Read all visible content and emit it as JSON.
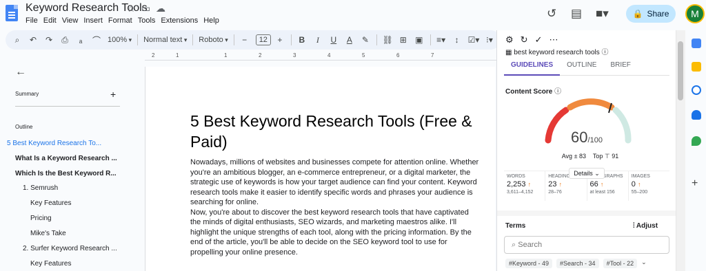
{
  "app": {
    "doc_title": "Keyword Research Tools",
    "menu": [
      "File",
      "Edit",
      "View",
      "Insert",
      "Format",
      "Tools",
      "Extensions",
      "Help"
    ],
    "share_label": "Share",
    "avatar_initial": "M"
  },
  "toolbar": {
    "zoom": "100%",
    "style": "Normal text",
    "font": "Roboto",
    "font_size": "12"
  },
  "ruler": [
    "2",
    "1",
    "1",
    "2",
    "3",
    "4",
    "5",
    "6",
    "7"
  ],
  "outline": {
    "summary_label": "Summary",
    "outline_label": "Outline",
    "items": [
      {
        "label": "5 Best Keyword Research To...",
        "level": "h1",
        "active": true
      },
      {
        "label": "What Is a Keyword Research ...",
        "level": "h1",
        "active": false
      },
      {
        "label": "Which Is the Best Keyword R...",
        "level": "h1",
        "active": false
      },
      {
        "label": "1. Semrush",
        "level": "h2",
        "active": false
      },
      {
        "label": "Key Features",
        "level": "h3",
        "active": false
      },
      {
        "label": "Pricing",
        "level": "h3",
        "active": false
      },
      {
        "label": "Mike's Take",
        "level": "h3",
        "active": false
      },
      {
        "label": "2. Surfer Keyword Research ...",
        "level": "h2",
        "active": false
      },
      {
        "label": "Key Features",
        "level": "h3",
        "active": false
      }
    ]
  },
  "document": {
    "heading": "5 Best Keyword Research Tools (Free & Paid)",
    "paragraphs": [
      "Nowadays, millions of websites and businesses compete for attention online. Whether you're an ambitious blogger, an e-commerce entrepreneur, or a digital marketer, the strategic use of keywords is how your target audience can find your content. Keyword research tools make it easier to identify specific words and phrases your audience is searching for online.",
      "Now, you're about to discover the best keyword research tools that have captivated the minds of digital enthusiasts, SEO wizards, and marketing maestros alike. I'll highlight the unique strengths of each tool, along with the pricing information. By the end of the article, you'll be able to decide on the SEO keyword tool to use for propelling your online presence."
    ]
  },
  "seo_panel": {
    "keyword": "best keyword research tools",
    "tabs": [
      "GUIDELINES",
      "OUTLINE",
      "BRIEF"
    ],
    "content_score_label": "Content Score",
    "score": "60",
    "score_max": "/100",
    "score_fraction": 0.6,
    "avg_label": "Avg",
    "avg": "83",
    "top_label": "Top",
    "top": "91",
    "details_label": "Details",
    "stats": [
      {
        "label": "WORDS",
        "value": "2,253",
        "range": "3,611–4,152"
      },
      {
        "label": "HEADINGS",
        "value": "23",
        "range": "28–76"
      },
      {
        "label": "PARAGRAPHS",
        "value": "66",
        "range": "at least 156"
      },
      {
        "label": "IMAGES",
        "value": "0",
        "range": "55–200"
      }
    ],
    "terms_label": "Terms",
    "adjust_label": "Adjust",
    "search_placeholder": "Search",
    "chips": [
      "#Keyword - 49",
      "#Search - 34",
      "#Tool - 22"
    ]
  },
  "colors": {
    "accent": "#5b4ab8",
    "gauge_red": "#e53935",
    "gauge_orange": "#f08a3e",
    "gauge_mint": "#cfe9e3",
    "link_blue": "#1a73e8"
  }
}
